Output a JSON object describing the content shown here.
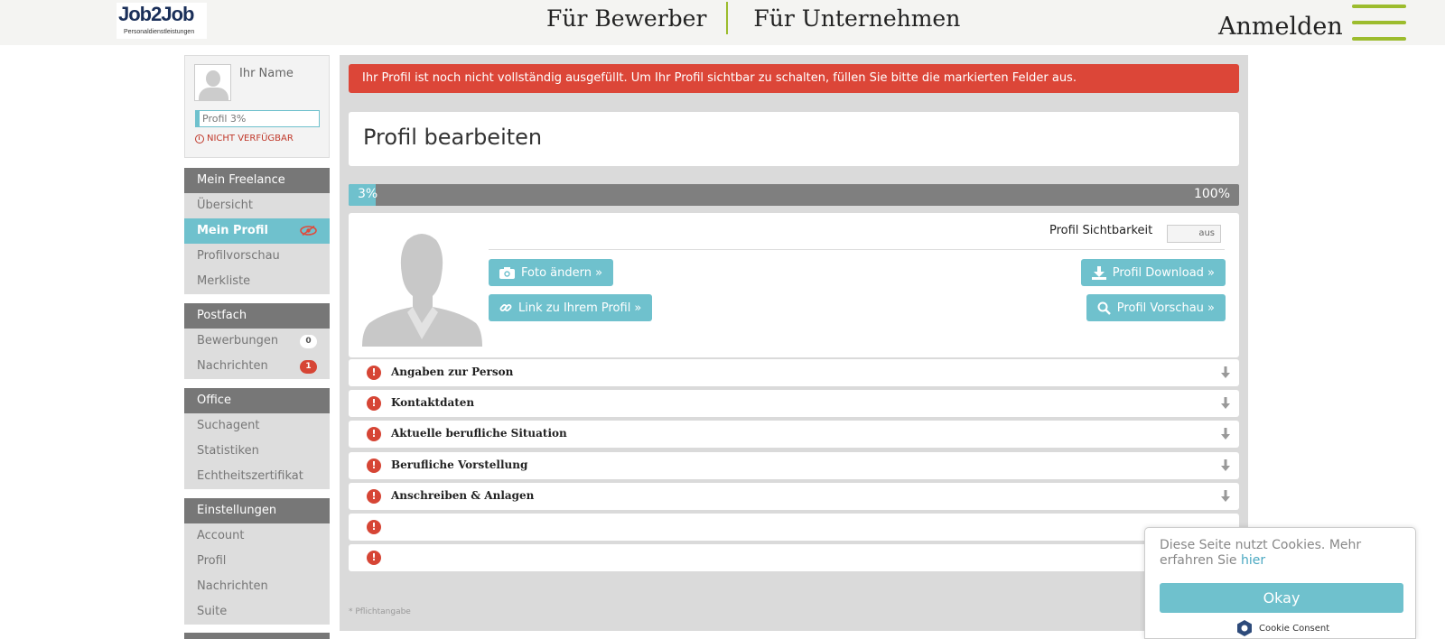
{
  "header": {
    "logo_text": "Job2Job",
    "logo_sub": "Personaldienstleistungen",
    "nav": [
      "Für Bewerber",
      "Für Unternehmen"
    ],
    "login": "Anmelden"
  },
  "profile_card": {
    "name": "Ihr Name",
    "progress_label": "Profil 3%",
    "progress": 0.03,
    "status": "NICHT VERFÜGBAR"
  },
  "sidebar": {
    "groups": [
      {
        "title": "Mein Freelance",
        "items": [
          "Übersicht",
          "Mein Profil",
          "Profilvorschau",
          "Merkliste"
        ]
      },
      {
        "title": "Postfach",
        "items": [
          "Bewerbungen",
          "Nachrichten"
        ],
        "badges": [
          "0",
          "1"
        ]
      },
      {
        "title": "Office",
        "items": [
          "Suchagent",
          "Statistiken",
          "Echtheitszertifikat"
        ]
      },
      {
        "title": "Einstellungen",
        "items": [
          "Account",
          "Profil",
          "Nachrichten",
          "Suite"
        ]
      }
    ]
  },
  "main": {
    "alert": "Ihr Profil ist noch nicht vollständig ausgefüllt. Um Ihr Profil sichtbar zu schalten, füllen Sie bitte die markierten Felder aus.",
    "title": "Profil bearbeiten",
    "progress": {
      "start": "3%",
      "end": "100%",
      "value": 0.03
    },
    "visibility_label": "Profil Sichtbarkeit",
    "visibility_value": "aus",
    "buttons": {
      "foto": "Foto ändern »",
      "link": "Link zu Ihrem Profil »",
      "download": "Profil Download »",
      "preview": "Profil Vorschau »"
    },
    "sections": [
      "Angaben zur Person",
      "Kontaktdaten",
      "Aktuelle berufliche Situation",
      "Berufliche Vorstellung",
      "Anschreiben & Anlagen",
      "",
      ""
    ],
    "footnote": "* Pflichtangabe"
  },
  "cookie": {
    "message": "Diese Seite nutzt Cookies. Mehr erfahren Sie",
    "link": "hier",
    "button": "Okay",
    "brand": "Cookie Consent"
  },
  "colors": {
    "accent": "#6fc1cd",
    "alert": "#dc4638",
    "brand_green": "#9cbc2d"
  }
}
